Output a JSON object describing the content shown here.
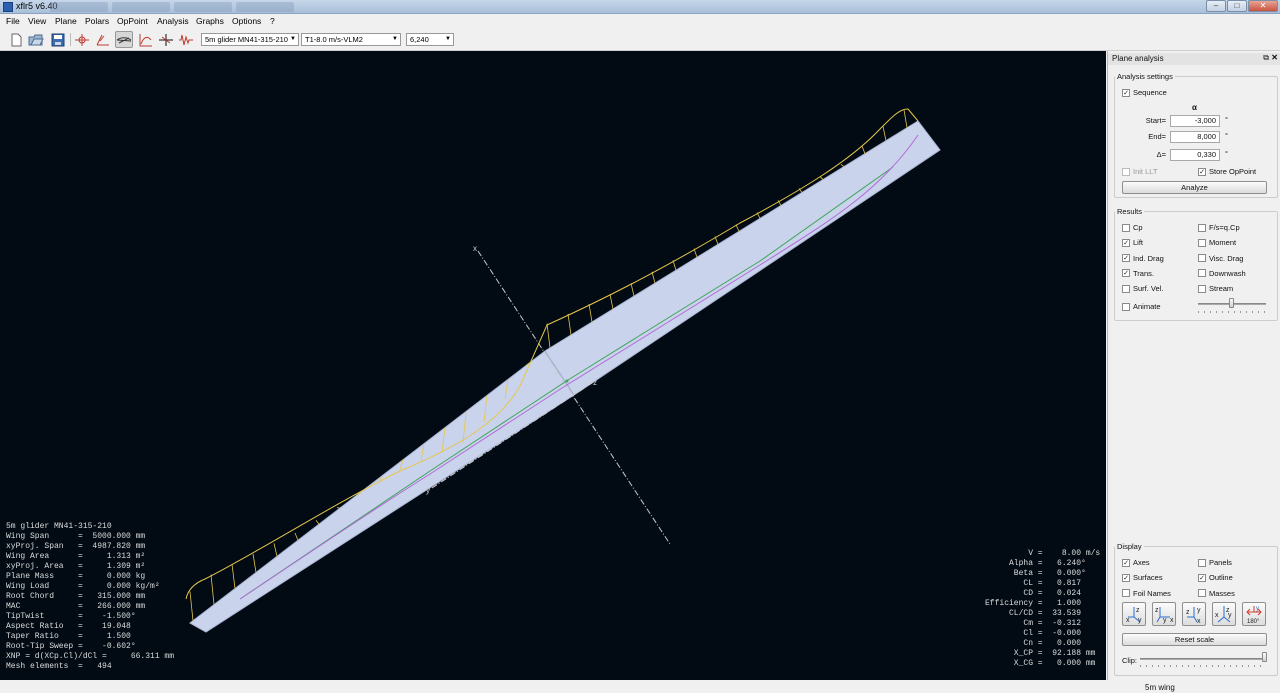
{
  "window": {
    "title": "xflr5 v6.40",
    "controls": [
      "–",
      "□",
      "✕"
    ]
  },
  "menu": [
    "File",
    "View",
    "Plane",
    "Polars",
    "OpPoint",
    "Analysis",
    "Graphs",
    "Options",
    "?"
  ],
  "toolbar": {
    "plane_select": "5m glider MN41-315-210",
    "polar_select": "T1-8.0 m/s-VLM2",
    "opp_select": "6,240",
    "icons": [
      "new-file-icon",
      "open-folder-icon",
      "save-icon",
      "wing-front-view-icon",
      "wing-side-view-icon",
      "plane-3d-view-icon",
      "polar-view-icon",
      "cp-view-icon",
      "oppoint-graph-icon"
    ]
  },
  "viewport": {
    "axis_labels": {
      "x": "x",
      "y": "y",
      "z": "z"
    },
    "info_left": [
      "5m glider MN41-315-210",
      "Wing Span      =  5000.000 mm",
      "xyProj. Span   =  4987.820 mm",
      "Wing Area      =     1.313 m²",
      "xyProj. Area   =     1.309 m²",
      "Plane Mass     =     0.000 kg",
      "Wing Load      =     0.000 kg/m²",
      "Root Chord     =   315.000 mm",
      "MAC            =   266.000 mm",
      "TipTwist       =    -1.500°",
      "Aspect Ratio   =    19.048",
      "Taper Ratio    =     1.500",
      "Root-Tip Sweep =    -0.602°",
      "XNP = d(XCp.Cl)/dCl =     66.311 mm",
      "Mesh elements  =   494"
    ],
    "info_right": [
      "         V =    8.00 m/s",
      "     Alpha =   6.240°",
      "      Beta =   0.000°",
      "        CL =   0.817",
      "        CD =   0.024",
      "Efficiency =   1.000",
      "     CL/CD =  33.539",
      "        Cm =  -0.312",
      "        Cl =  -0.000",
      "        Cn =   0.000",
      "      X_CP =  92.188 mm",
      "      X_CG =   0.000 mm"
    ]
  },
  "dock": {
    "title": "Plane analysis",
    "float_icon": "⧉",
    "close_icon": "✕",
    "analysis_settings": {
      "title": "Analysis settings",
      "sequence_label": "Sequence",
      "sequence_checked": true,
      "alpha_symbol": "α",
      "start_label": "Start=",
      "start_value": "-3,000",
      "end_label": "End=",
      "end_value": "8,000",
      "delta_label": "Δ=",
      "delta_value": "0,330",
      "unit": "°",
      "init_llt_label": "Init LLT",
      "store_opp_label": "Store OpPoint",
      "analyze_label": "Analyze"
    },
    "results": {
      "title": "Results",
      "items": [
        {
          "label": "Cp",
          "checked": false
        },
        {
          "label": "F/s=q.Cp",
          "checked": false
        },
        {
          "label": "Lift",
          "checked": true
        },
        {
          "label": "Moment",
          "checked": false
        },
        {
          "label": "Ind. Drag",
          "checked": true
        },
        {
          "label": "Visc. Drag",
          "checked": false
        },
        {
          "label": "Trans.",
          "checked": true
        },
        {
          "label": "Downwash",
          "checked": false
        },
        {
          "label": "Surf. Vel.",
          "checked": false
        },
        {
          "label": "Stream",
          "checked": false
        }
      ],
      "animate_label": "Animate",
      "animate_checked": false
    },
    "display": {
      "title": "Display",
      "items": [
        {
          "label": "Axes",
          "checked": true
        },
        {
          "label": "Panels",
          "checked": false
        },
        {
          "label": "Surfaces",
          "checked": true
        },
        {
          "label": "Outline",
          "checked": true
        },
        {
          "label": "Foil Names",
          "checked": false
        },
        {
          "label": "Masses",
          "checked": false
        }
      ],
      "view_buttons": [
        "x-y-view-icon",
        "y-x-view-icon",
        "z-x-view-icon",
        "x-y-iso-view-icon",
        "flip-180-view-icon"
      ],
      "flip_label": "180°",
      "reset_scale_label": "Reset scale",
      "clip_label": "Clip:"
    }
  },
  "status": {
    "text": "5m wing"
  },
  "colors": {
    "viewport_bg": "#020b14",
    "wing_surface": "#c9d3ec",
    "lift_curve": "#e6c64a",
    "induced_drag_line": "#b36ad8",
    "transition_line": "#3fa55a"
  }
}
